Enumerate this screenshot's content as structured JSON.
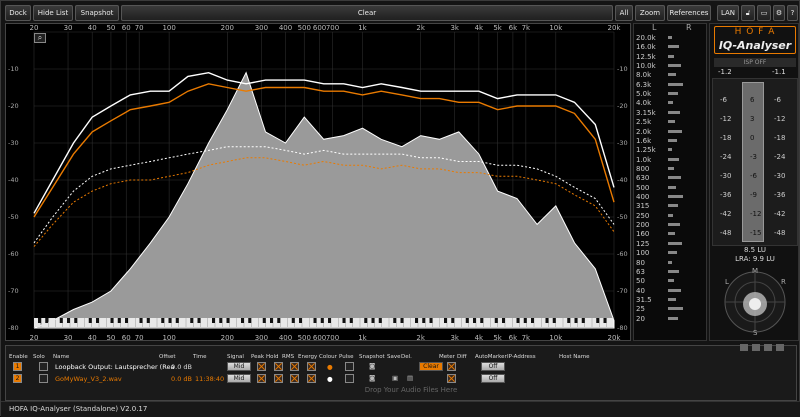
{
  "toolbar": {
    "dock": "Dock",
    "hide_list": "Hide List",
    "snapshot": "Snapshot",
    "clear": "Clear",
    "all": "All",
    "zoom": "Zoom",
    "references": "References",
    "lan": "LAN",
    "help": "?"
  },
  "spectrum": {
    "x_labels": [
      "20",
      "30",
      "40",
      "50",
      "60",
      "70",
      "100",
      "200",
      "300",
      "400",
      "500",
      "600",
      "700",
      "1k",
      "2k",
      "3k",
      "4k",
      "5k",
      "6k",
      "7k",
      "10k",
      "20k"
    ],
    "y_labels": [
      "-10",
      "-20",
      "-30",
      "-40",
      "-50",
      "-60",
      "-70",
      "-80"
    ],
    "y_labels_full": [
      "0",
      "-10",
      "-20",
      "-30",
      "-40",
      "-50",
      "-60",
      "-70",
      "-80"
    ]
  },
  "chart_data": {
    "type": "area",
    "xscale": "log",
    "xlim": [
      20,
      20000
    ],
    "ylim": [
      -80,
      0
    ],
    "x": [
      20,
      25,
      32,
      40,
      50,
      63,
      80,
      100,
      125,
      160,
      200,
      250,
      315,
      400,
      500,
      630,
      800,
      1000,
      1250,
      1600,
      2000,
      2500,
      3150,
      4000,
      5000,
      6300,
      8000,
      10000,
      12500,
      16000,
      20000
    ],
    "series": [
      {
        "values": [
          -80,
          -78,
          -75,
          -73,
          -70,
          -64,
          -57,
          -50,
          -41,
          -30,
          -21,
          -11,
          -27,
          -30,
          -23,
          -29,
          -28,
          -26,
          -29,
          -31,
          -28,
          -29,
          -27,
          -33,
          -43,
          -45,
          -52,
          -47,
          -57,
          -64,
          -78
        ]
      },
      {
        "values": [
          -50,
          -42,
          -33,
          -27,
          -24,
          -21,
          -20,
          -19,
          -16,
          -14,
          -15,
          -16,
          -15,
          -15,
          -15,
          -16,
          -16,
          -17,
          -16,
          -17,
          -18,
          -18,
          -19,
          -19,
          -21,
          -20,
          -20,
          -20,
          -22,
          -29,
          -46
        ]
      },
      {
        "values": [
          -49,
          -40,
          -30,
          -23,
          -20,
          -17,
          -16,
          -16,
          -12,
          -11,
          -13,
          -14,
          -13,
          -13,
          -13,
          -14,
          -14,
          -15,
          -14,
          -15,
          -16,
          -16,
          -16,
          -16,
          -18,
          -17,
          -17,
          -17,
          -19,
          -25,
          -42
        ]
      },
      {
        "values": [
          -58,
          -52,
          -46,
          -43,
          -41,
          -40,
          -40,
          -39,
          -38,
          -36,
          -35,
          -34,
          -34,
          -35,
          -36,
          -35,
          -36,
          -36,
          -37,
          -36,
          -37,
          -37,
          -38,
          -38,
          -39,
          -39,
          -40,
          -41,
          -44,
          -47,
          -54
        ]
      },
      {
        "values": [
          -57,
          -50,
          -43,
          -39,
          -37,
          -36,
          -35,
          -34,
          -33,
          -32,
          -31,
          -31,
          -31,
          -32,
          -33,
          -32,
          -33,
          -33,
          -33,
          -33,
          -34,
          -34,
          -35,
          -35,
          -36,
          -36,
          -37,
          -39,
          -42,
          -45,
          -52
        ]
      }
    ]
  },
  "bars": {
    "L": "L",
    "R": "R",
    "freqs": [
      "20.0k",
      "16.0k",
      "12.5k",
      "10.0k",
      "8.0k",
      "6.3k",
      "5.0k",
      "4.0k",
      "3.15k",
      "2.5k",
      "2.0k",
      "1.6k",
      "1.25k",
      "1.0k",
      "800",
      "630",
      "500",
      "400",
      "315",
      "250",
      "200",
      "160",
      "125",
      "100",
      "80",
      "63",
      "50",
      "40",
      "31.5",
      "25",
      "20"
    ]
  },
  "meter": {
    "brand1": "H O F A",
    "brand2": "IQ-Analyser",
    "isp": "ISP OFF",
    "peak_l": "-1.2",
    "peak_r": "-1.1",
    "scale_left": [
      "-6",
      "-12",
      "-18",
      "-24",
      "-30",
      "-36",
      "-42",
      "-48"
    ],
    "scale_center": [
      "6",
      "3",
      "0",
      "-3",
      "-6",
      "-9",
      "-12",
      "-15"
    ],
    "scale_right": [
      "-6",
      "-12",
      "-18",
      "-24",
      "-30",
      "-36",
      "-42",
      "-48"
    ],
    "lu": "8.5 LU",
    "lra": "LRA: 9.9 LU",
    "l": "L",
    "r": "R",
    "m": "M",
    "s": "S"
  },
  "mixer": {
    "headers": [
      "Enable",
      "Solo",
      "Name",
      "Offset",
      "Time",
      "Signal",
      "Peak",
      "Hold",
      "RMS",
      "Energy",
      "Colour",
      "Pulse",
      "Snapshot",
      "Save",
      "Del.",
      "Meter",
      "Diff",
      "AutoMarker",
      "IP-Address",
      "Host Name"
    ],
    "rows": [
      {
        "num": "1",
        "name": "Loopback Output: Lautsprecher (Rea",
        "offset": "0.0 dB",
        "time": "",
        "signal": "Mid",
        "clear": "Clear",
        "automarker": "Off"
      },
      {
        "num": "2",
        "name": "GoMyWay_V3_2.wav",
        "offset": "0.0 dB",
        "time": "11:38:40",
        "signal": "Mid",
        "automarker": "Off"
      }
    ],
    "drop_hint": "Drop Your Audio Files Here"
  },
  "status": "HOFA IQ-Analyser (Standalone) V2.0.17",
  "colors": {
    "orange": "#e97a00",
    "white": "#ffffff",
    "fill": "#9a9a9a"
  }
}
